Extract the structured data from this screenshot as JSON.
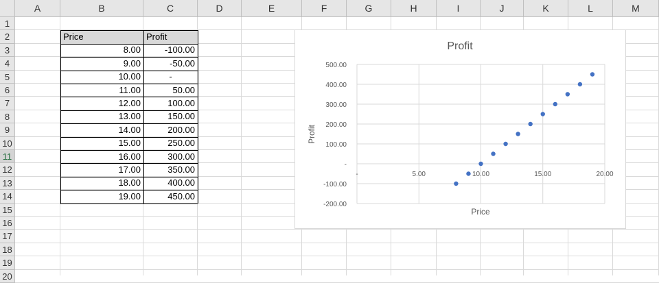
{
  "columns": [
    "A",
    "B",
    "C",
    "D",
    "E",
    "F",
    "G",
    "H",
    "I",
    "J",
    "K",
    "L",
    "M"
  ],
  "rows": [
    "1",
    "2",
    "3",
    "4",
    "5",
    "6",
    "7",
    "8",
    "9",
    "10",
    "11",
    "12",
    "13",
    "14",
    "15",
    "16",
    "17",
    "18",
    "19",
    "20"
  ],
  "selected_row": "11",
  "table": {
    "headers": [
      "Price",
      "Profit"
    ],
    "rows": [
      [
        "8.00",
        "-100.00"
      ],
      [
        "9.00",
        "-50.00"
      ],
      [
        "10.00",
        "-"
      ],
      [
        "11.00",
        "50.00"
      ],
      [
        "12.00",
        "100.00"
      ],
      [
        "13.00",
        "150.00"
      ],
      [
        "14.00",
        "200.00"
      ],
      [
        "15.00",
        "250.00"
      ],
      [
        "16.00",
        "300.00"
      ],
      [
        "17.00",
        "350.00"
      ],
      [
        "18.00",
        "400.00"
      ],
      [
        "19.00",
        "450.00"
      ]
    ]
  },
  "colors": {
    "marker": "#4472c4",
    "header_bg": "#e6e6e6",
    "gridline": "#d9d9d9"
  },
  "chart_data": {
    "type": "scatter",
    "title": "Profit",
    "xlabel": "Price",
    "ylabel": "Profit",
    "xlim": [
      0,
      20
    ],
    "ylim": [
      -200,
      500
    ],
    "x_ticks": [
      "-",
      "5.00",
      "10.00",
      "15.00",
      "20.00"
    ],
    "y_ticks": [
      "500.00",
      "400.00",
      "300.00",
      "200.00",
      "100.00",
      "-",
      "-100.00",
      "-200.00"
    ],
    "grid": true,
    "legend": "none",
    "series": [
      {
        "x": [
          8,
          9,
          10,
          11,
          12,
          13,
          14,
          15,
          16,
          17,
          18,
          19
        ],
        "y": [
          -100,
          -50,
          0,
          50,
          100,
          150,
          200,
          250,
          300,
          350,
          400,
          450
        ]
      }
    ]
  }
}
